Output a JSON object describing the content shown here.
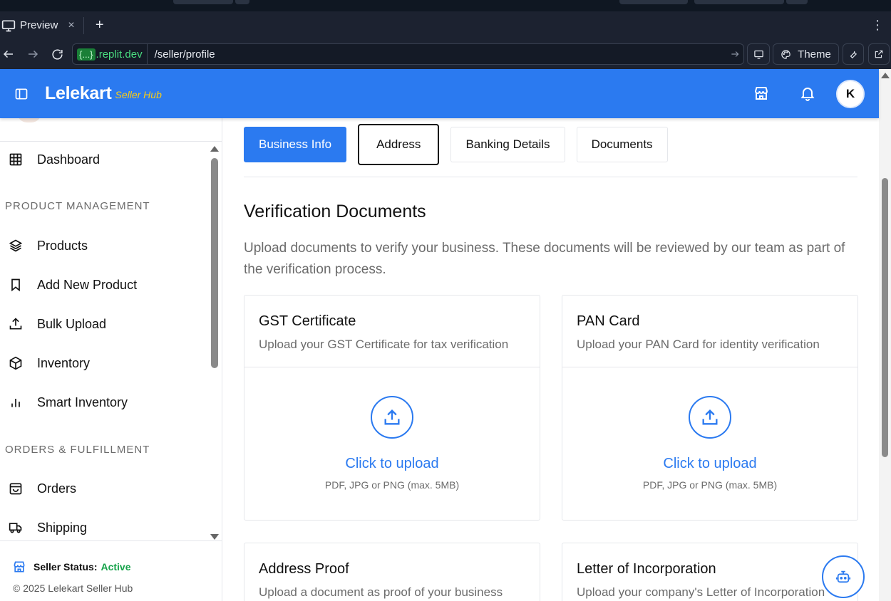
{
  "browser": {
    "tab_title": "Preview",
    "tab_close": "×",
    "new_tab": "+",
    "menu": "⋮",
    "url_host_brace": "{...}",
    "url_host_domain": ".replit.dev",
    "url_path": "/seller/profile",
    "theme_label": "Theme"
  },
  "header": {
    "brand": "Lelekart",
    "brand_sub": "Seller Hub",
    "avatar_initial": "K"
  },
  "sidebar": {
    "dashboard": "Dashboard",
    "section_product": "PRODUCT MANAGEMENT",
    "products": "Products",
    "add_new_product": "Add New Product",
    "bulk_upload": "Bulk Upload",
    "inventory": "Inventory",
    "smart_inventory": "Smart Inventory",
    "section_orders": "ORDERS & FULFILLMENT",
    "orders": "Orders",
    "shipping": "Shipping",
    "status_label": "Seller Status:",
    "status_value": "Active",
    "copyright": "© 2025 Lelekart Seller Hub"
  },
  "tabs": {
    "business_info": "Business Info",
    "address": "Address",
    "banking_details": "Banking Details",
    "documents": "Documents"
  },
  "section": {
    "title": "Verification Documents",
    "description": "Upload documents to verify your business. These documents will be reviewed by our team as part of the verification process."
  },
  "cards": [
    {
      "title": "GST Certificate",
      "subtitle": "Upload your GST Certificate for tax verification",
      "action": "Click to upload",
      "hint": "PDF, JPG or PNG (max. 5MB)"
    },
    {
      "title": "PAN Card",
      "subtitle": "Upload your PAN Card for identity verification",
      "action": "Click to upload",
      "hint": "PDF, JPG or PNG (max. 5MB)"
    },
    {
      "title": "Address Proof",
      "subtitle": "Upload a document as proof of your business"
    },
    {
      "title": "Letter of Incorporation",
      "subtitle": "Upload your company's Letter of Incorporation"
    }
  ],
  "colors": {
    "brand_blue": "#2b7af0",
    "brand_sub_yellow": "#facc15",
    "status_green": "#16a34a"
  }
}
